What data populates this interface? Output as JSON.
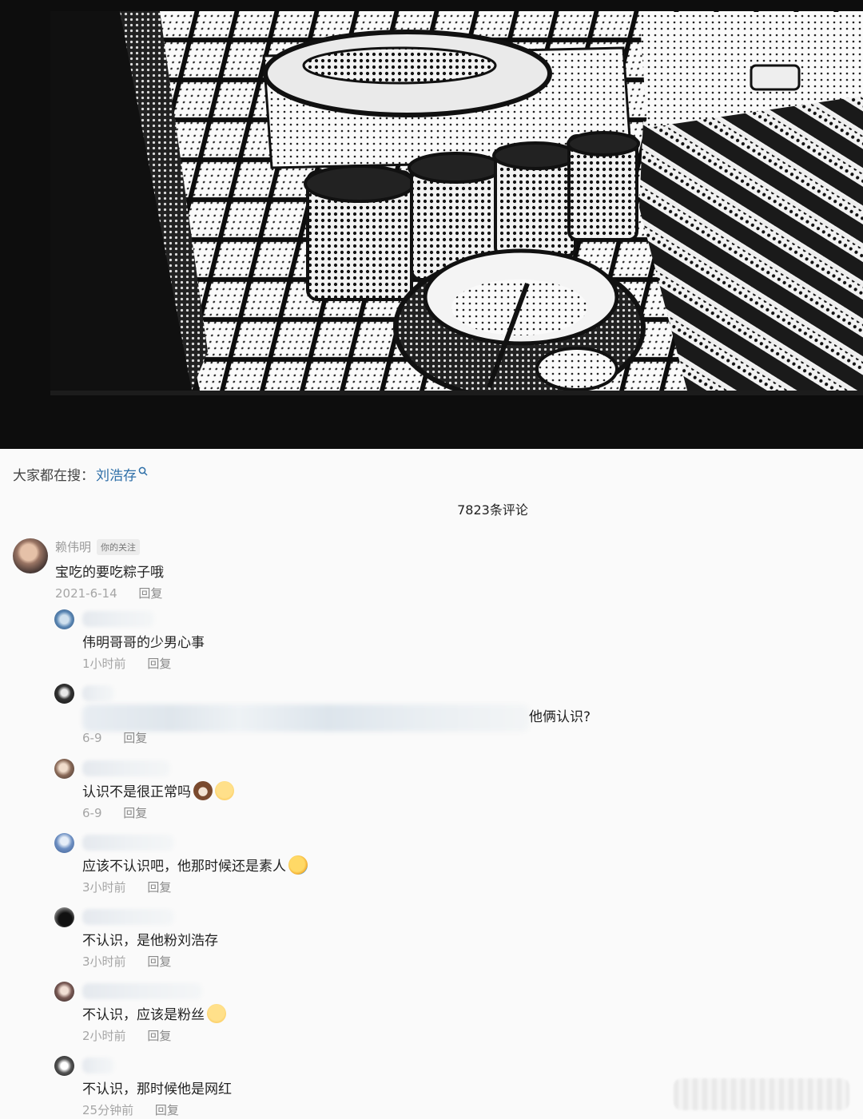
{
  "search_hint": {
    "prefix": "大家都在搜：",
    "keyword": "刘浩存"
  },
  "comment_count": "7823条评论",
  "main_comment": {
    "user": "赖伟明",
    "badge": "你的关注",
    "text": "宝吃的要吃粽子哦",
    "date": "2021-6-14",
    "reply_label": "回复"
  },
  "replies": [
    {
      "text": "伟明哥哥的少男心事",
      "time": "1小时前",
      "reply_label": "回复"
    },
    {
      "text": "他俩认识?",
      "time": "6-9",
      "reply_label": "回复"
    },
    {
      "text": "认识不是很正常吗",
      "time": "6-9",
      "reply_label": "回复"
    },
    {
      "text": "应该不认识吧，他那时候还是素人",
      "time": "3小时前",
      "reply_label": "回复"
    },
    {
      "text": "不认识，是他粉刘浩存",
      "time": "3小时前",
      "reply_label": "回复"
    },
    {
      "text": "不认识，应该是粉丝",
      "time": "2小时前",
      "reply_label": "回复"
    },
    {
      "text": "不认识，那时候他是网红",
      "time": "25分钟前",
      "reply_label": "回复"
    }
  ],
  "icons": [
    "search-icon",
    "bear-emoji-icon",
    "shy-emoji-icon",
    "laugh-cry-emoji-icon",
    "thinking-emoji-icon"
  ],
  "colors": {
    "link": "#2e6fa8",
    "meta": "#a5a5a5",
    "background": "#fafafa"
  }
}
